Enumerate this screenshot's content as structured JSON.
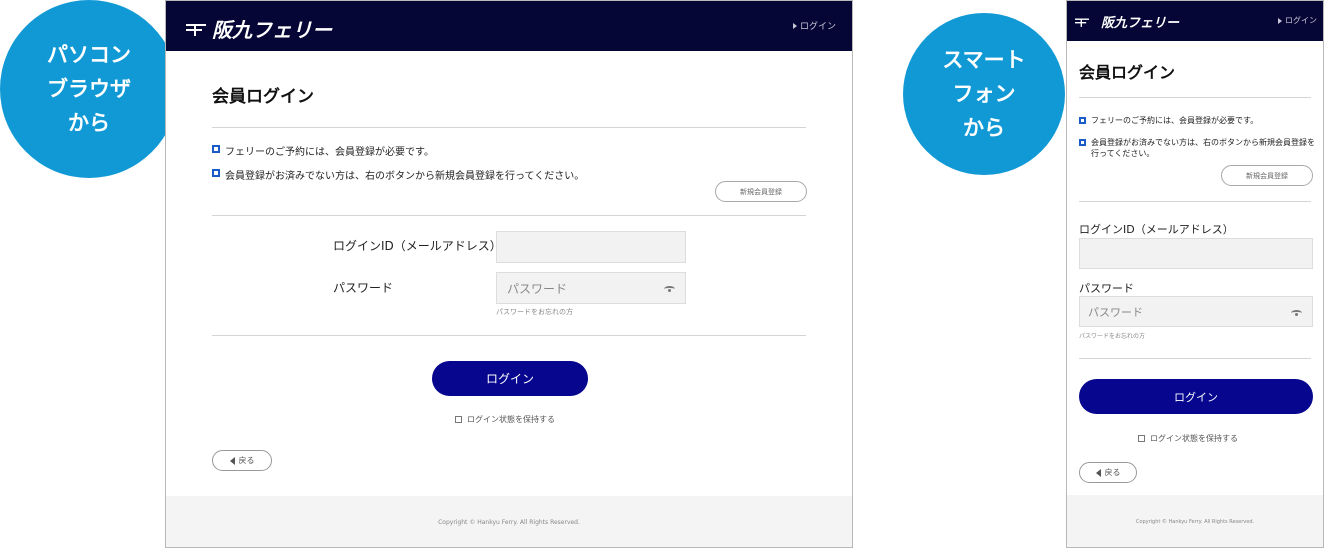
{
  "badges": {
    "pc": [
      "パソコン",
      "ブラウザ",
      "から"
    ],
    "sp": [
      "スマート",
      "フォン",
      "から"
    ]
  },
  "colors": {
    "header": "#050636",
    "primary_button": "#06068f",
    "badge": "#1199d5",
    "bullet": "#1a5cc7"
  },
  "brand": {
    "logo_text": "阪九フェリー",
    "logo_icon": "hankyu-ferry-mark-icon"
  },
  "header": {
    "login_link": "ログイン"
  },
  "page": {
    "title": "会員ログイン",
    "notes": [
      "フェリーのご予約には、会員登録が必要です。",
      "会員登録がお済みでない方は、右のボタンから新規会員登録を行ってください。"
    ],
    "register_button": "新規会員登録"
  },
  "form": {
    "login_id_label": "ログインID（メールアドレス）",
    "login_id_value": "",
    "password_label": "パスワード",
    "password_placeholder": "パスワード",
    "forgot_link": "パスワードをお忘れの方",
    "login_button": "ログイン",
    "keep_logged_in": "ログイン状態を保持する",
    "keep_logged_in_checked": false
  },
  "nav": {
    "back_button": "戻る"
  },
  "footer": {
    "copyright": "Copyright © Hankyu Ferry. All Rights Reserved."
  }
}
